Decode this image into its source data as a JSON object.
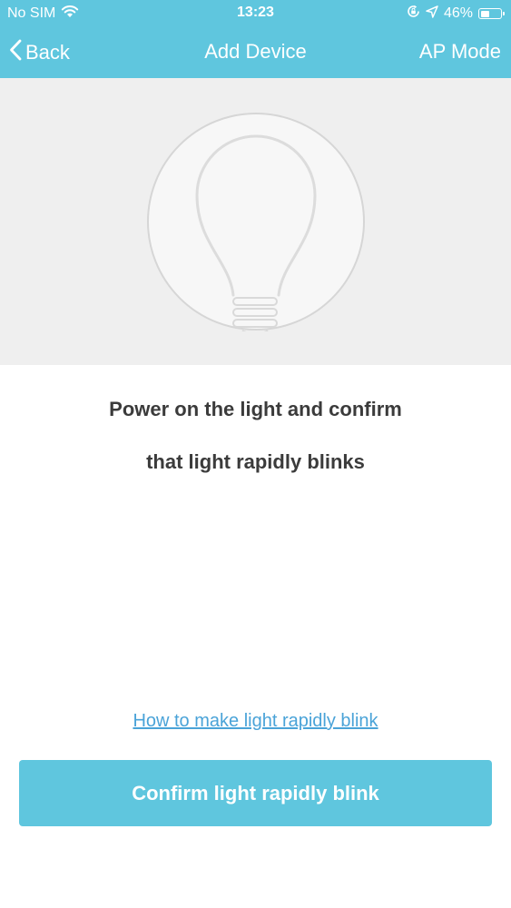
{
  "status_bar": {
    "carrier": "No SIM",
    "time": "13:23",
    "battery_percent": "46%",
    "battery_level": 0.46
  },
  "nav": {
    "back_label": "Back",
    "title": "Add Device",
    "right_label": "AP Mode"
  },
  "instructions": {
    "line1": "Power on the light and confirm",
    "line2": "that light rapidly blinks"
  },
  "help_link": "How to make light rapidly blink",
  "confirm_button": "Confirm light rapidly blink",
  "colors": {
    "accent": "#5fc6de",
    "link": "#4aa3d8",
    "illustration_bg": "#efefef",
    "text": "#3b3b3b"
  }
}
